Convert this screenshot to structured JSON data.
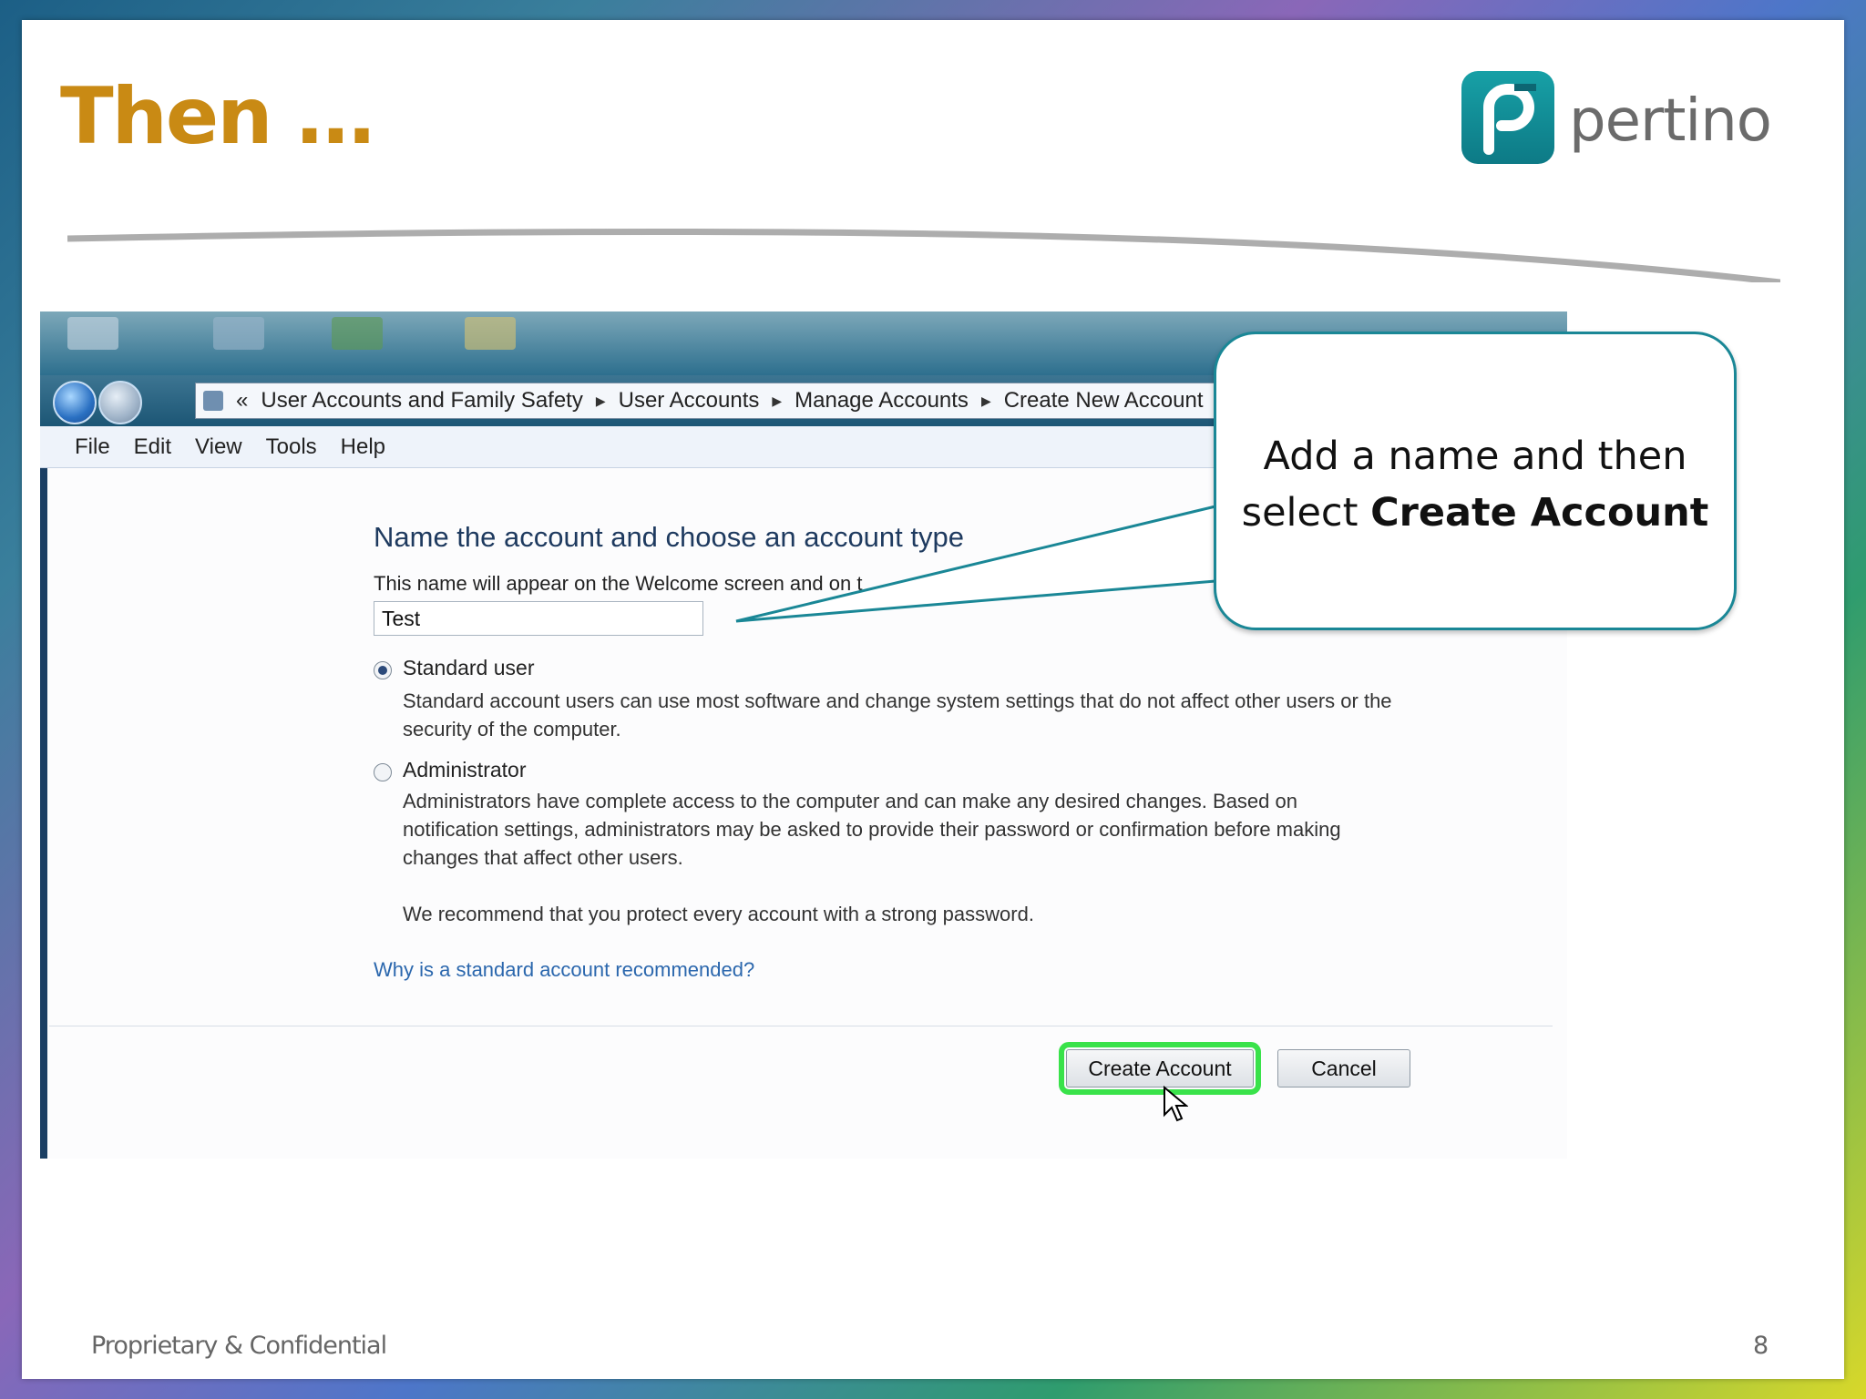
{
  "slide": {
    "title": "Then …",
    "logo_text": "pertino",
    "footer": "Proprietary & Confidential",
    "page_number": "8"
  },
  "window": {
    "breadcrumb": {
      "prefix": "«",
      "items": [
        "User Accounts and Family Safety",
        "User Accounts",
        "Manage Accounts",
        "Create New Account"
      ]
    },
    "menu": [
      "File",
      "Edit",
      "View",
      "Tools",
      "Help"
    ],
    "heading": "Name the account and choose an account type",
    "name_label": "This name will appear on the Welcome screen and on t",
    "name_value": "Test",
    "options": [
      {
        "label": "Standard user",
        "selected": true,
        "description": "Standard account users can use most software and change system settings that do not affect other users or the security of the computer."
      },
      {
        "label": "Administrator",
        "selected": false,
        "description": "Administrators have complete access to the computer and can make any desired changes. Based on notification settings, administrators may be asked to provide their password or confirmation before making changes that affect other users."
      }
    ],
    "recommendation": "We recommend that you protect every account with a strong password.",
    "help_link": "Why is a standard account recommended?",
    "buttons": {
      "create": "Create Account",
      "cancel": "Cancel"
    }
  },
  "callout": {
    "line1": "Add a name and then",
    "line2_prefix": "select ",
    "line2_bold": "Create Account"
  },
  "colors": {
    "title": "#c98a14",
    "accent": "#1a8796",
    "highlight": "#39e24a"
  }
}
